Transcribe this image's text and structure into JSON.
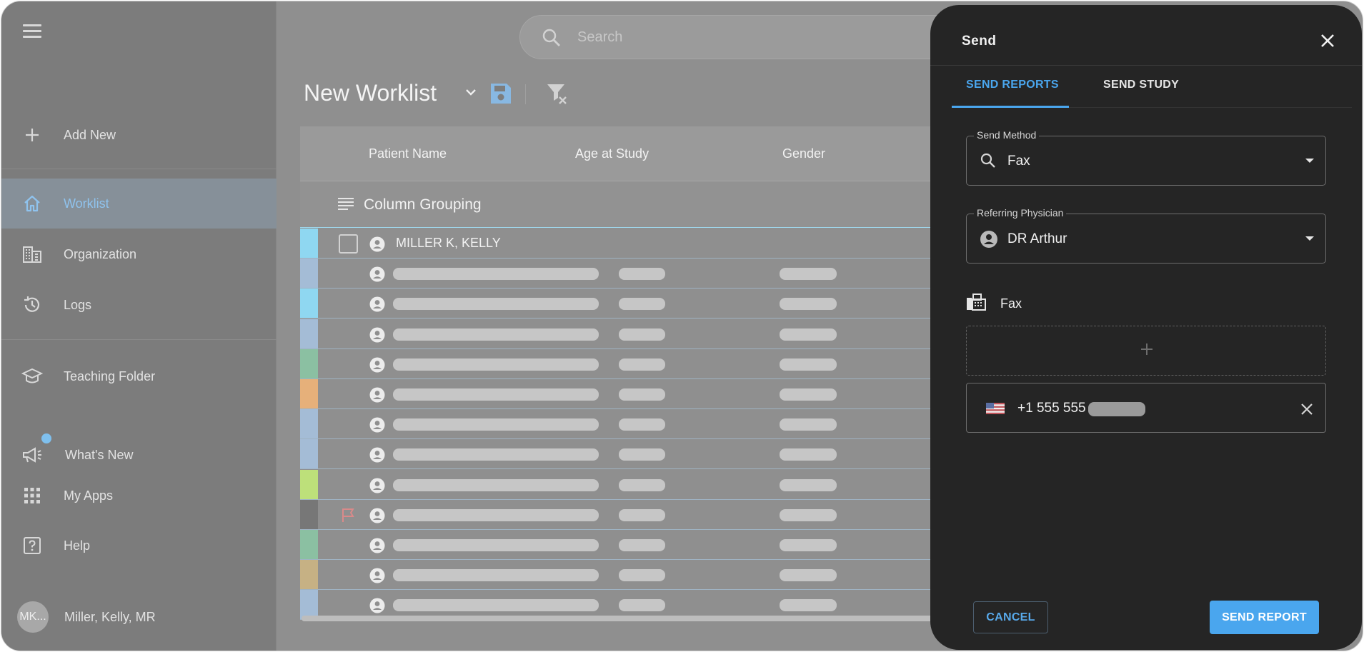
{
  "sidebar": {
    "items": [
      {
        "label": "Add New",
        "icon": "plus-icon"
      },
      {
        "label": "Worklist",
        "icon": "home-icon",
        "active": true
      },
      {
        "label": "Organization",
        "icon": "building-icon"
      },
      {
        "label": "Logs",
        "icon": "history-icon"
      },
      {
        "label": "Teaching Folder",
        "icon": "graduation-cap-icon"
      },
      {
        "label": "What's New",
        "icon": "megaphone-icon"
      },
      {
        "label": "My Apps",
        "icon": "grid-apps-icon"
      },
      {
        "label": "Help",
        "icon": "help-icon"
      }
    ],
    "user": {
      "initials": "MK...",
      "name": "Miller, Kelly, MR"
    }
  },
  "search": {
    "placeholder": "Search"
  },
  "worklist": {
    "title": "New Worklist",
    "columns": [
      "Patient Name",
      "Age at Study",
      "Gender"
    ],
    "grouping_label": "Column Grouping",
    "first_row_name": "MILLER K, KELLY",
    "row_colors": [
      "#8fd7f1",
      "#a4bcd6",
      "#8fd7f1",
      "#a4bcd6",
      "#8bc0a2",
      "#e6b07a",
      "#a4bcd6",
      "#a4bcd6",
      "#bde07a",
      "#777777",
      "#8bc0a2",
      "#c6b184",
      "#a4bcd6"
    ]
  },
  "dialog": {
    "title": "Send",
    "tabs": {
      "reports": "SEND REPORTS",
      "study": "SEND STUDY",
      "active": "SEND REPORTS"
    },
    "send_method": {
      "label": "Send Method",
      "value": "Fax"
    },
    "referring_physician": {
      "label": "Referring Physician",
      "value": "DR Arthur"
    },
    "fax_section_label": "Fax",
    "fax_number": "+1 555 555",
    "cancel_label": "CANCEL",
    "send_label": "SEND REPORT"
  },
  "colors": {
    "accent": "#4aa6ee",
    "dialog_bg": "#252525",
    "overlay": "#8f8f8f"
  }
}
